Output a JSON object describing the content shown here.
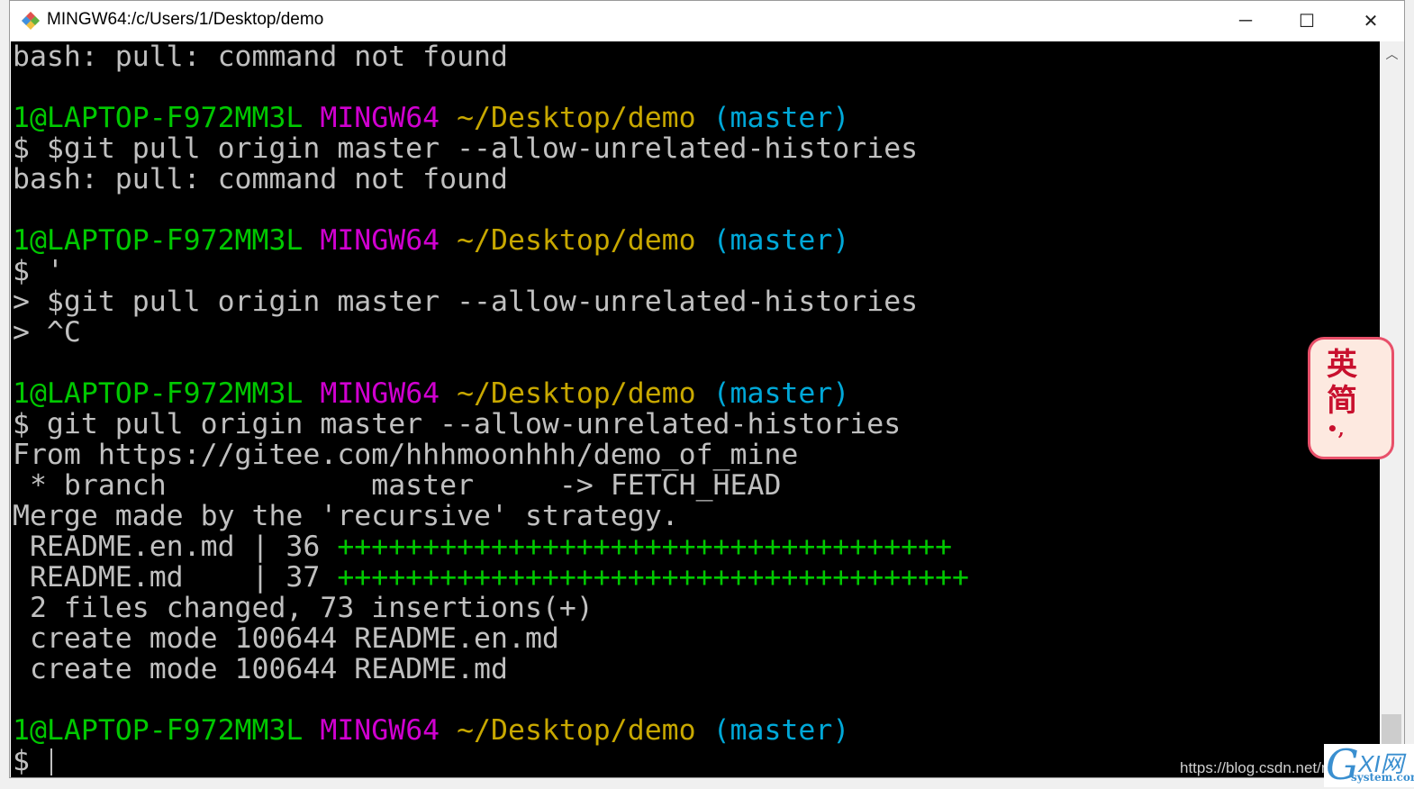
{
  "window": {
    "title": "MINGW64:/c/Users/1/Desktop/demo",
    "minimize": "─",
    "maximize": "☐",
    "close": "✕"
  },
  "colors": {
    "text": "#c0c0c0",
    "user": "#00c800",
    "system": "#d000d0",
    "path": "#c8a800",
    "branch": "#00a8d8",
    "plus": "#00c800"
  },
  "terminal": {
    "lines": [
      [
        {
          "t": "bash: pull: command not found",
          "c": "text"
        }
      ],
      [],
      [
        {
          "t": "1@LAPTOP-F972MM3L ",
          "c": "user"
        },
        {
          "t": "MINGW64 ",
          "c": "system"
        },
        {
          "t": "~/Desktop/demo ",
          "c": "path"
        },
        {
          "t": "(master)",
          "c": "branch"
        }
      ],
      [
        {
          "t": "$ $git pull origin master --allow-unrelated-histories",
          "c": "text"
        }
      ],
      [
        {
          "t": "bash: pull: command not found",
          "c": "text"
        }
      ],
      [],
      [
        {
          "t": "1@LAPTOP-F972MM3L ",
          "c": "user"
        },
        {
          "t": "MINGW64 ",
          "c": "system"
        },
        {
          "t": "~/Desktop/demo ",
          "c": "path"
        },
        {
          "t": "(master)",
          "c": "branch"
        }
      ],
      [
        {
          "t": "$ '",
          "c": "text"
        }
      ],
      [
        {
          "t": "> $git pull origin master --allow-unrelated-histories",
          "c": "text"
        }
      ],
      [
        {
          "t": "> ^C",
          "c": "text"
        }
      ],
      [],
      [
        {
          "t": "1@LAPTOP-F972MM3L ",
          "c": "user"
        },
        {
          "t": "MINGW64 ",
          "c": "system"
        },
        {
          "t": "~/Desktop/demo ",
          "c": "path"
        },
        {
          "t": "(master)",
          "c": "branch"
        }
      ],
      [
        {
          "t": "$ git pull origin master --allow-unrelated-histories",
          "c": "text"
        }
      ],
      [
        {
          "t": "From https://gitee.com/hhhmoonhhh/demo_of_mine",
          "c": "text"
        }
      ],
      [
        {
          "t": " * branch            master     -> FETCH_HEAD",
          "c": "text"
        }
      ],
      [
        {
          "t": "Merge made by the 'recursive' strategy.",
          "c": "text"
        }
      ],
      [
        {
          "t": " README.en.md | 36 ",
          "c": "text"
        },
        {
          "t": "++++++++++++++++++++++++++++++++++++",
          "c": "plus"
        }
      ],
      [
        {
          "t": " README.md    | 37 ",
          "c": "text"
        },
        {
          "t": "+++++++++++++++++++++++++++++++++++++",
          "c": "plus"
        }
      ],
      [
        {
          "t": " 2 files changed, 73 insertions(+)",
          "c": "text"
        }
      ],
      [
        {
          "t": " create mode 100644 README.en.md",
          "c": "text"
        }
      ],
      [
        {
          "t": " create mode 100644 README.md",
          "c": "text"
        }
      ],
      [],
      [
        {
          "t": "1@LAPTOP-F972MM3L ",
          "c": "user"
        },
        {
          "t": "MINGW64 ",
          "c": "system"
        },
        {
          "t": "~/Desktop/demo ",
          "c": "path"
        },
        {
          "t": "(master)",
          "c": "branch"
        }
      ],
      [
        {
          "t": "$ ",
          "c": "text"
        }
      ]
    ]
  },
  "ime": {
    "lang": "英",
    "mode": "简",
    "punct": "•,"
  },
  "watermark": "https://blog.csdn.net/m",
  "logo": {
    "g": "G",
    "xi": "XI网",
    "sub": "system.com"
  }
}
